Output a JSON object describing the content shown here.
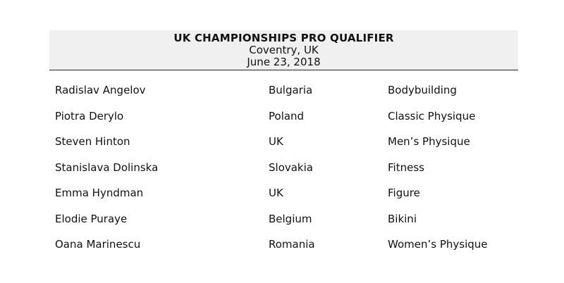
{
  "header": {
    "title": "UK CHAMPIONSHIPS PRO QUALIFIER",
    "location": "Coventry, UK",
    "date": "June 23, 2018"
  },
  "rows": [
    {
      "name": "Radislav Angelov",
      "country": "Bulgaria",
      "division": "Bodybuilding"
    },
    {
      "name": "Piotra Derylo",
      "country": "Poland",
      "division": "Classic Physique"
    },
    {
      "name": "Steven Hinton",
      "country": "UK",
      "division": "Men’s Physique"
    },
    {
      "name": "Stanislava Dolinska",
      "country": "Slovakia",
      "division": "Fitness"
    },
    {
      "name": "Emma Hyndman",
      "country": "UK",
      "division": "Figure"
    },
    {
      "name": "Elodie Puraye",
      "country": "Belgium",
      "division": "Bikini"
    },
    {
      "name": "Oana Marinescu",
      "country": "Romania",
      "division": "Women’s Physique"
    }
  ]
}
